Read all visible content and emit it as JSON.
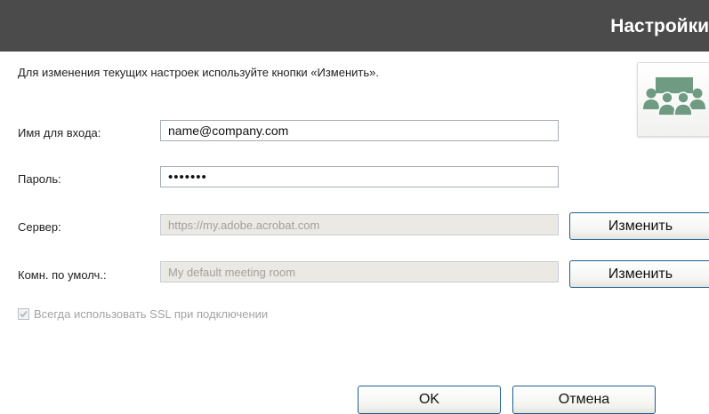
{
  "header": {
    "title": "Настройки"
  },
  "intro_text": "Для изменения текущих настроек используйте кнопки «Изменить».",
  "logo": {
    "icon": "meeting-room-icon",
    "color": "#6f9b83"
  },
  "fields": {
    "login": {
      "label": "Имя для входа:",
      "value": "name@company.com"
    },
    "password": {
      "label": "Пароль:",
      "value": "•••••••"
    },
    "server": {
      "label": "Сервер:",
      "value": "https://my.adobe.acrobat.com",
      "change_label": "Изменить"
    },
    "room": {
      "label": "Комн. по умолч.:",
      "value": "My default meeting room",
      "change_label": "Изменить"
    }
  },
  "ssl": {
    "label": "Всегда использовать SSL при подключении",
    "checked": true
  },
  "buttons": {
    "ok": "OK",
    "cancel": "Отмена"
  },
  "colors": {
    "header_bg": "#4b4b4b",
    "button_border": "#1f5f91",
    "disabled_bg": "#ebe9e3"
  }
}
